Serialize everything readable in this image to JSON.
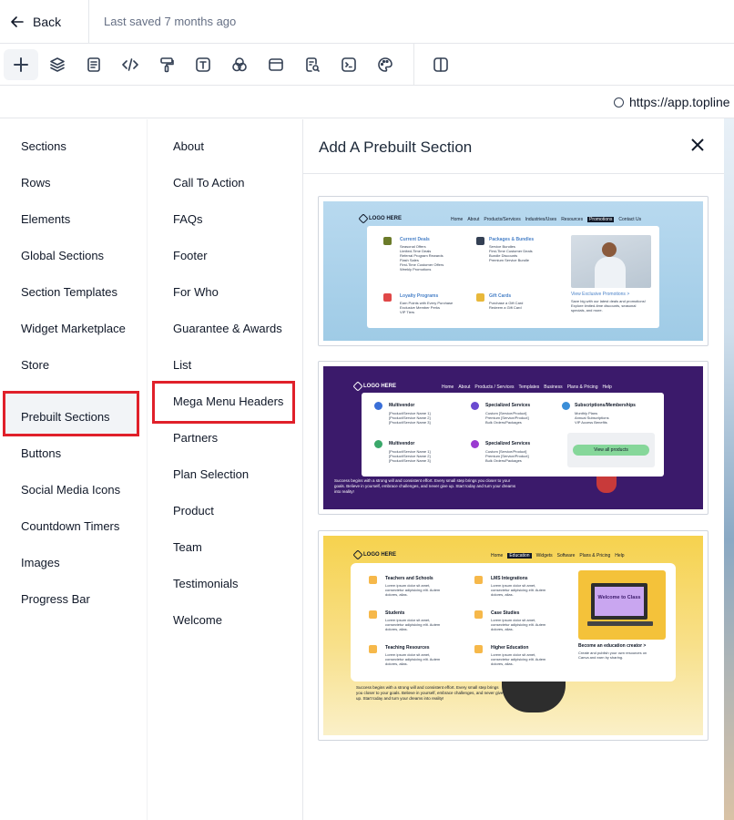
{
  "header": {
    "back_label": "Back",
    "saved_text": "Last saved 7 months ago"
  },
  "toolbar": {
    "tools": [
      "plus-icon",
      "layers-icon",
      "page-icon",
      "code-icon",
      "paint-roller-icon",
      "text-icon",
      "shapes-icon",
      "browser-window-icon",
      "search-doc-icon",
      "terminal-icon",
      "palette-icon"
    ],
    "extra_tool": "split-view-icon"
  },
  "browser": {
    "url": "https://app.topline"
  },
  "sidebar": {
    "items": [
      "Sections",
      "Rows",
      "Elements",
      "Global Sections",
      "Section Templates",
      "Widget Marketplace",
      "Store",
      "Prebuilt Sections",
      "Buttons",
      "Social Media Icons",
      "Countdown Timers",
      "Images",
      "Progress Bar"
    ],
    "selected": "Prebuilt Sections"
  },
  "categories": {
    "items": [
      "About",
      "Call To Action",
      "FAQs",
      "Footer",
      "For Who",
      "Guarantee & Awards",
      "List",
      "Mega Menu Headers",
      "Partners",
      "Plan Selection",
      "Product",
      "Team",
      "Testimonials",
      "Welcome"
    ],
    "selected": "Mega Menu Headers"
  },
  "panel": {
    "title": "Add A Prebuilt Section",
    "previews": [
      {
        "logo": "LOGO HERE",
        "nav": [
          "Home",
          "About",
          "Products/Services",
          "Industries/Uses",
          "Resources",
          "Promotions",
          "Contact Us"
        ],
        "highlight": "Promotions",
        "groups": [
          {
            "title": "Current Deals",
            "lines": "Seasonal Offers\nLimited-Time Deals\nReferral Program Rewards\nFlash Sales\nFirst-Time Customer Offers\nWeekly Promotions"
          },
          {
            "title": "Packages & Bundles",
            "lines": "Service Bundles\nFirst-Time Customer Deals\nBundle Discounts\nPremium Service Bundle"
          },
          {
            "title": "Loyalty Programs",
            "lines": "Earn Points with Every Purchase\nExclusive Member Perks\nVIP Tiers"
          },
          {
            "title": "Gift Cards",
            "lines": "Purchase a Gift Card\nRedeem a Gift Card"
          }
        ],
        "promo_title": "View Exclusive Promotions >",
        "promo_text": "Save big with our latest deals and promotions!\nExplore limited-time discounts, seasonal\nspecials, and more."
      },
      {
        "logo": "LOGO HERE",
        "nav": [
          "Home",
          "About",
          "Products / Services",
          "Templates",
          "Business",
          "Plans & Pricing",
          "Help"
        ],
        "groups": [
          {
            "title": "Multivendor",
            "lines": "[Product/Service Name 1]\n[Product/Service Name 2]\n[Product/Service Name 3]"
          },
          {
            "title": "Specialized Services",
            "lines": "Custom [Service/Product]\nPremium [Service/Product]\nBulk Orders/Packages"
          },
          {
            "title": "Subscriptions/Memberships",
            "lines": "Monthly Plans\nAnnual Subscriptions\nVIP Access Benefits"
          },
          {
            "title": "Multivendor",
            "lines": "[Product/Service Name 1]\n[Product/Service Name 2]\n[Product/Service Name 3]"
          },
          {
            "title": "Specialized Services",
            "lines": "Custom [Service/Product]\nPremium [Service/Product]\nBulk Orders/Packages"
          }
        ],
        "button": "View all products",
        "footer": "Success begins with a strong will and consistent effort. Every small step brings you closer to your\ngoals. Believe in yourself, embrace challenges, and never give up. Start today and turn your dreams\ninto reality!"
      },
      {
        "logo": "LOGO HERE",
        "nav": [
          "Home",
          "Education",
          "Widgets",
          "Software",
          "Plans & Pricing",
          "Help"
        ],
        "highlight": "Education",
        "groups": [
          {
            "title": "Teachers and Schools",
            "lines": "Lorem ipsum dolor sit amet,\nconsectetur adipisicing elit. Autem\ndolores, alias."
          },
          {
            "title": "LMS Integrations",
            "lines": "Lorem ipsum dolor sit amet,\nconsectetur adipisicing elit. Autem\ndolores, alias."
          },
          {
            "title": "Students",
            "lines": "Lorem ipsum dolor sit amet,\nconsectetur adipisicing elit. Autem\ndolores, alias."
          },
          {
            "title": "Case Studies",
            "lines": "Lorem ipsum dolor sit amet,\nconsectetur adipisicing elit. Autem\ndolores, alias."
          },
          {
            "title": "Teaching Resources",
            "lines": "Lorem ipsum dolor sit amet,\nconsectetur adipisicing elit. Autem\ndolores, alias."
          },
          {
            "title": "Higher Education",
            "lines": "Lorem ipsum dolor sit amet,\nconsectetur adipisicing elit. Autem\ndolores, alias."
          }
        ],
        "promo_screen": "Welcome to Class",
        "promo_title": "Become an education creator >",
        "promo_text": "Create and publish your own resources on\nCanva and earn by sharing.",
        "footer": "Success begins with a strong will and consistent effort. Every small step brings\nyou closer to your goals. Believe in yourself, embrace challenges, and never give\nup. Start today and turn your dreams into reality!"
      }
    ]
  },
  "colors": {
    "selection_border": "#e0202a",
    "selected_bg": "#f2f4f7",
    "preview2_bg": "#3b1a6b",
    "preview3_bg": "#f6d24e",
    "button_green": "#86d79a"
  }
}
